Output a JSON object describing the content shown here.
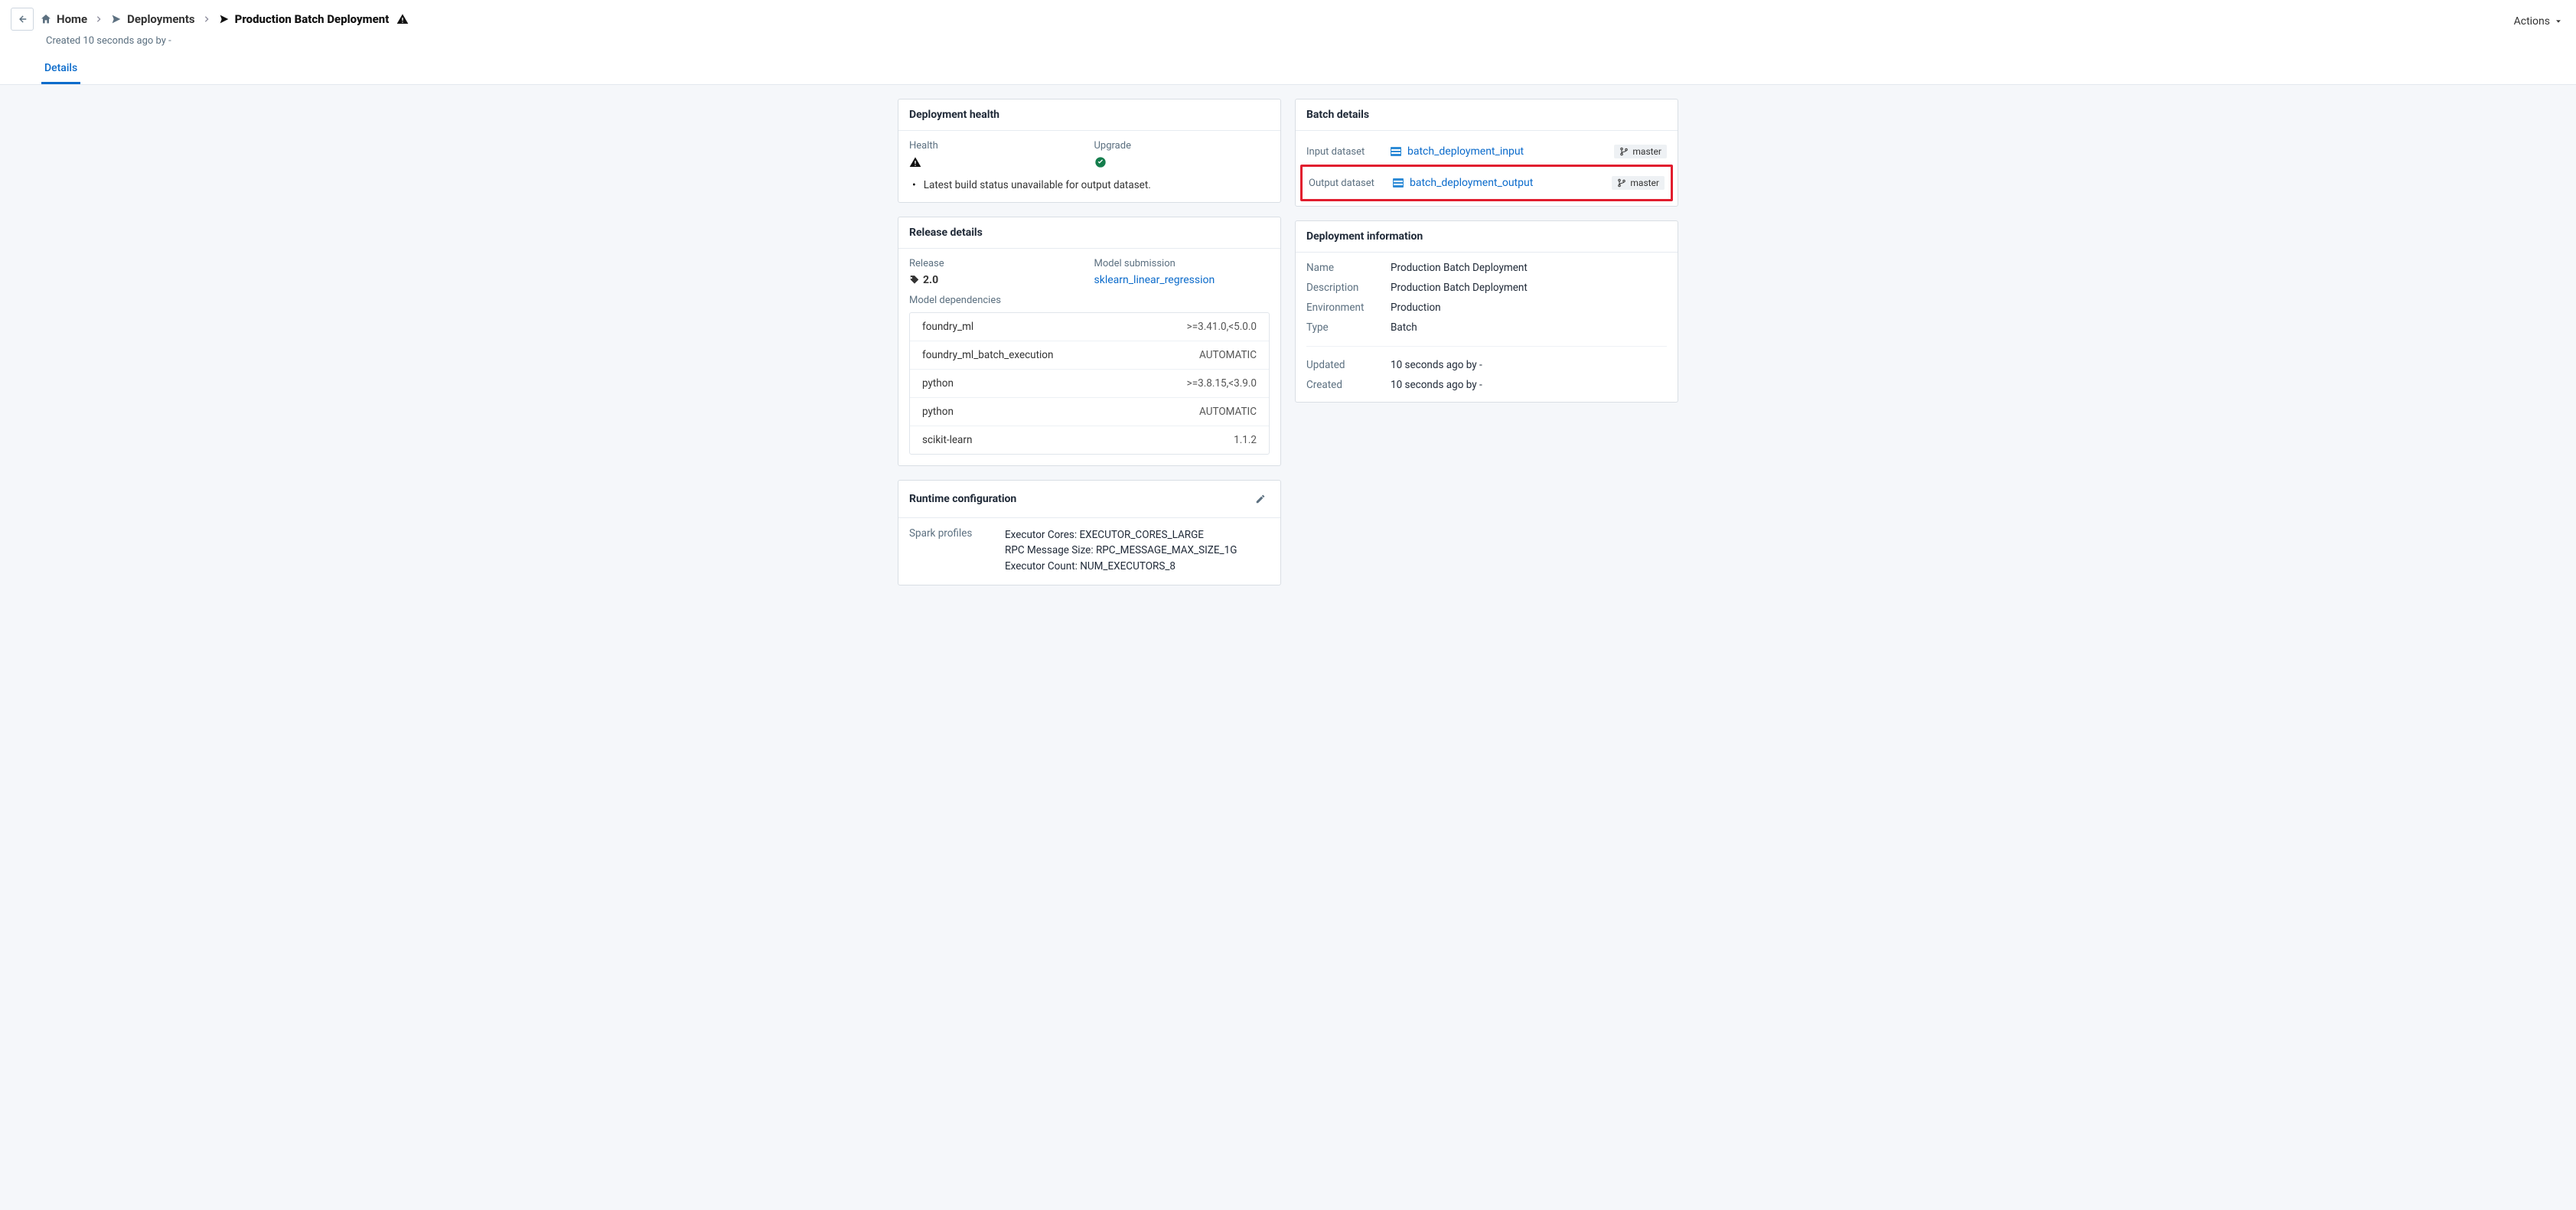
{
  "header": {
    "breadcrumbs": {
      "home": "Home",
      "deployments": "Deployments",
      "current": "Production Batch Deployment"
    },
    "subtitle": "Created 10 seconds ago by -",
    "actions_label": "Actions"
  },
  "tabs": {
    "details": "Details"
  },
  "health_card": {
    "title": "Deployment health",
    "health_label": "Health",
    "upgrade_label": "Upgrade",
    "message": "Latest build status unavailable for output dataset."
  },
  "release_card": {
    "title": "Release details",
    "release_label": "Release",
    "release_value": "2.0",
    "submission_label": "Model submission",
    "submission_value": "sklearn_linear_regression",
    "deps_label": "Model dependencies",
    "deps": [
      {
        "name": "foundry_ml",
        "ver": ">=3.41.0,<5.0.0"
      },
      {
        "name": "foundry_ml_batch_execution",
        "ver": "AUTOMATIC"
      },
      {
        "name": "python",
        "ver": ">=3.8.15,<3.9.0"
      },
      {
        "name": "python",
        "ver": "AUTOMATIC"
      },
      {
        "name": "scikit-learn",
        "ver": "1.1.2"
      }
    ]
  },
  "runtime_card": {
    "title": "Runtime configuration",
    "label": "Spark profiles",
    "lines": [
      "Executor Cores: EXECUTOR_CORES_LARGE",
      "RPC Message Size: RPC_MESSAGE_MAX_SIZE_1G",
      "Executor Count: NUM_EXECUTORS_8"
    ]
  },
  "batch_card": {
    "title": "Batch details",
    "input_label": "Input dataset",
    "input_name": "batch_deployment_input",
    "input_branch": "master",
    "output_label": "Output dataset",
    "output_name": "batch_deployment_output",
    "output_branch": "master"
  },
  "info_card": {
    "title": "Deployment information",
    "rows": {
      "name_k": "Name",
      "name_v": "Production Batch Deployment",
      "desc_k": "Description",
      "desc_v": "Production Batch Deployment",
      "env_k": "Environment",
      "env_v": "Production",
      "type_k": "Type",
      "type_v": "Batch",
      "upd_k": "Updated",
      "upd_v": "10 seconds ago by -",
      "crt_k": "Created",
      "crt_v": "10 seconds ago by -"
    }
  }
}
